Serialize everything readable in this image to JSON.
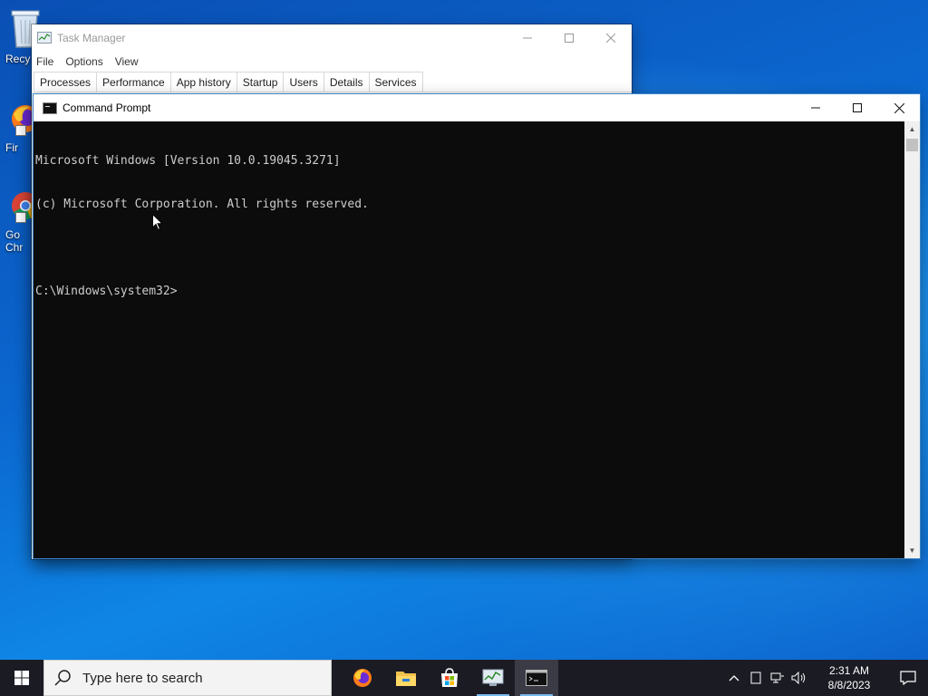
{
  "desktop": {
    "icons": [
      {
        "label": "Recy",
        "name": "recycle-bin-icon"
      },
      {
        "label": "Fir",
        "name": "firefox-desktop-icon"
      },
      {
        "label": "Go\nChr",
        "name": "chrome-desktop-icon"
      }
    ]
  },
  "task_manager": {
    "title": "Task Manager",
    "menu": [
      "File",
      "Options",
      "View"
    ],
    "tabs": [
      "Processes",
      "Performance",
      "App history",
      "Startup",
      "Users",
      "Details",
      "Services"
    ],
    "active_tab": "Processes"
  },
  "command_prompt": {
    "title": "Command Prompt",
    "lines": [
      "Microsoft Windows [Version 10.0.19045.3271]",
      "(c) Microsoft Corporation. All rights reserved.",
      "",
      "C:\\Windows\\system32>"
    ]
  },
  "taskbar": {
    "search_placeholder": "Type here to search",
    "apps": [
      "firefox-icon",
      "file-explorer-icon",
      "microsoft-store-icon",
      "task-manager-icon",
      "command-prompt-icon"
    ],
    "clock": {
      "time": "2:31 AM",
      "date": "8/8/2023"
    }
  },
  "colors": {
    "console_bg": "#0c0c0c",
    "console_text": "#cccccc",
    "taskbar_bg": "#1b1b24",
    "desktop_blue": "#0b67cf"
  }
}
